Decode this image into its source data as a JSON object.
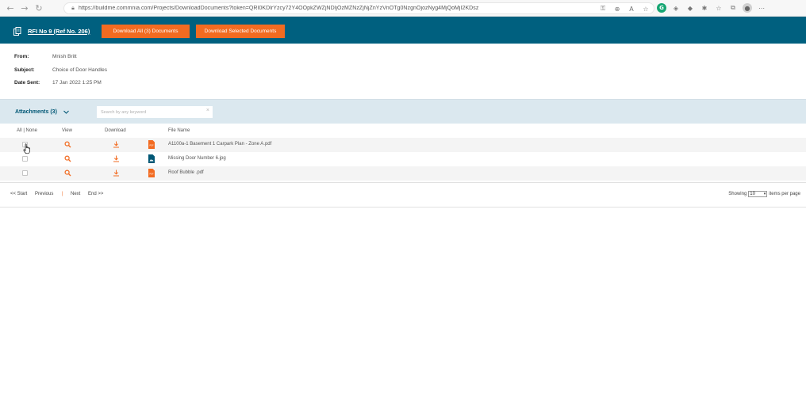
{
  "browser": {
    "url": "https://buildme.commnia.com/Projects/DownloadDocuments?token=QRI0KDlrYzcy72Y4OOpkZWZjNDljOzMZNzZjNjZnYzVnOTg0NzgnOjozNyg4MjQoMjI2KDsz"
  },
  "header": {
    "title": "RFI No 9 (Ref No. 206)",
    "download_all_label": "Download All (3) Documents",
    "download_selected_label": "Download Selected Documents",
    "bg_color": "#00607f",
    "accent_color": "#f26b21"
  },
  "info": {
    "from_label": "From:",
    "from_value": "Mnish Britt",
    "subject_label": "Subject:",
    "subject_value": "Choice of Door Handles",
    "date_label": "Date Sent:",
    "date_value": "17 Jan 2022 1:25 PM"
  },
  "attachments": {
    "title": "Attachments (3)",
    "search_placeholder": "Search by any keyword"
  },
  "table": {
    "headers": {
      "select": "All | None",
      "view": "View",
      "download": "Download",
      "file_name": "File Name"
    },
    "rows": [
      {
        "file_name": "A1100a-1 Basement 1 Carpark Plan - Zone A.pdf",
        "file_type": "pdf-icon"
      },
      {
        "file_name": "Missing Door Number 6.jpg",
        "file_type": "image-icon"
      },
      {
        "file_name": "Roof Bubble .pdf",
        "file_type": "pdf-icon"
      }
    ]
  },
  "pagination": {
    "start": "<< Start",
    "previous": "Previous",
    "separator": "|",
    "next": "Next",
    "end": "End >>",
    "showing_label": "Showing",
    "per_page_value": "10",
    "per_page_suffix": "items per page"
  }
}
